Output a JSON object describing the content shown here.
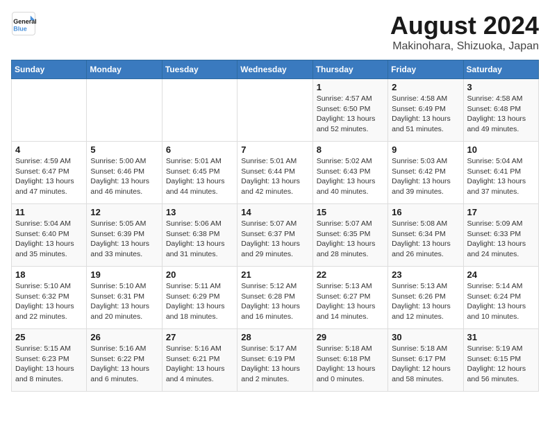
{
  "logo": {
    "line1": "General",
    "line2": "Blue"
  },
  "title": "August 2024",
  "subtitle": "Makinohara, Shizuoka, Japan",
  "days_of_week": [
    "Sunday",
    "Monday",
    "Tuesday",
    "Wednesday",
    "Thursday",
    "Friday",
    "Saturday"
  ],
  "weeks": [
    [
      {
        "day": "",
        "info": ""
      },
      {
        "day": "",
        "info": ""
      },
      {
        "day": "",
        "info": ""
      },
      {
        "day": "",
        "info": ""
      },
      {
        "day": "1",
        "info": "Sunrise: 4:57 AM\nSunset: 6:50 PM\nDaylight: 13 hours\nand 52 minutes."
      },
      {
        "day": "2",
        "info": "Sunrise: 4:58 AM\nSunset: 6:49 PM\nDaylight: 13 hours\nand 51 minutes."
      },
      {
        "day": "3",
        "info": "Sunrise: 4:58 AM\nSunset: 6:48 PM\nDaylight: 13 hours\nand 49 minutes."
      }
    ],
    [
      {
        "day": "4",
        "info": "Sunrise: 4:59 AM\nSunset: 6:47 PM\nDaylight: 13 hours\nand 47 minutes."
      },
      {
        "day": "5",
        "info": "Sunrise: 5:00 AM\nSunset: 6:46 PM\nDaylight: 13 hours\nand 46 minutes."
      },
      {
        "day": "6",
        "info": "Sunrise: 5:01 AM\nSunset: 6:45 PM\nDaylight: 13 hours\nand 44 minutes."
      },
      {
        "day": "7",
        "info": "Sunrise: 5:01 AM\nSunset: 6:44 PM\nDaylight: 13 hours\nand 42 minutes."
      },
      {
        "day": "8",
        "info": "Sunrise: 5:02 AM\nSunset: 6:43 PM\nDaylight: 13 hours\nand 40 minutes."
      },
      {
        "day": "9",
        "info": "Sunrise: 5:03 AM\nSunset: 6:42 PM\nDaylight: 13 hours\nand 39 minutes."
      },
      {
        "day": "10",
        "info": "Sunrise: 5:04 AM\nSunset: 6:41 PM\nDaylight: 13 hours\nand 37 minutes."
      }
    ],
    [
      {
        "day": "11",
        "info": "Sunrise: 5:04 AM\nSunset: 6:40 PM\nDaylight: 13 hours\nand 35 minutes."
      },
      {
        "day": "12",
        "info": "Sunrise: 5:05 AM\nSunset: 6:39 PM\nDaylight: 13 hours\nand 33 minutes."
      },
      {
        "day": "13",
        "info": "Sunrise: 5:06 AM\nSunset: 6:38 PM\nDaylight: 13 hours\nand 31 minutes."
      },
      {
        "day": "14",
        "info": "Sunrise: 5:07 AM\nSunset: 6:37 PM\nDaylight: 13 hours\nand 29 minutes."
      },
      {
        "day": "15",
        "info": "Sunrise: 5:07 AM\nSunset: 6:35 PM\nDaylight: 13 hours\nand 28 minutes."
      },
      {
        "day": "16",
        "info": "Sunrise: 5:08 AM\nSunset: 6:34 PM\nDaylight: 13 hours\nand 26 minutes."
      },
      {
        "day": "17",
        "info": "Sunrise: 5:09 AM\nSunset: 6:33 PM\nDaylight: 13 hours\nand 24 minutes."
      }
    ],
    [
      {
        "day": "18",
        "info": "Sunrise: 5:10 AM\nSunset: 6:32 PM\nDaylight: 13 hours\nand 22 minutes."
      },
      {
        "day": "19",
        "info": "Sunrise: 5:10 AM\nSunset: 6:31 PM\nDaylight: 13 hours\nand 20 minutes."
      },
      {
        "day": "20",
        "info": "Sunrise: 5:11 AM\nSunset: 6:29 PM\nDaylight: 13 hours\nand 18 minutes."
      },
      {
        "day": "21",
        "info": "Sunrise: 5:12 AM\nSunset: 6:28 PM\nDaylight: 13 hours\nand 16 minutes."
      },
      {
        "day": "22",
        "info": "Sunrise: 5:13 AM\nSunset: 6:27 PM\nDaylight: 13 hours\nand 14 minutes."
      },
      {
        "day": "23",
        "info": "Sunrise: 5:13 AM\nSunset: 6:26 PM\nDaylight: 13 hours\nand 12 minutes."
      },
      {
        "day": "24",
        "info": "Sunrise: 5:14 AM\nSunset: 6:24 PM\nDaylight: 13 hours\nand 10 minutes."
      }
    ],
    [
      {
        "day": "25",
        "info": "Sunrise: 5:15 AM\nSunset: 6:23 PM\nDaylight: 13 hours\nand 8 minutes."
      },
      {
        "day": "26",
        "info": "Sunrise: 5:16 AM\nSunset: 6:22 PM\nDaylight: 13 hours\nand 6 minutes."
      },
      {
        "day": "27",
        "info": "Sunrise: 5:16 AM\nSunset: 6:21 PM\nDaylight: 13 hours\nand 4 minutes."
      },
      {
        "day": "28",
        "info": "Sunrise: 5:17 AM\nSunset: 6:19 PM\nDaylight: 13 hours\nand 2 minutes."
      },
      {
        "day": "29",
        "info": "Sunrise: 5:18 AM\nSunset: 6:18 PM\nDaylight: 13 hours\nand 0 minutes."
      },
      {
        "day": "30",
        "info": "Sunrise: 5:18 AM\nSunset: 6:17 PM\nDaylight: 12 hours\nand 58 minutes."
      },
      {
        "day": "31",
        "info": "Sunrise: 5:19 AM\nSunset: 6:15 PM\nDaylight: 12 hours\nand 56 minutes."
      }
    ]
  ]
}
